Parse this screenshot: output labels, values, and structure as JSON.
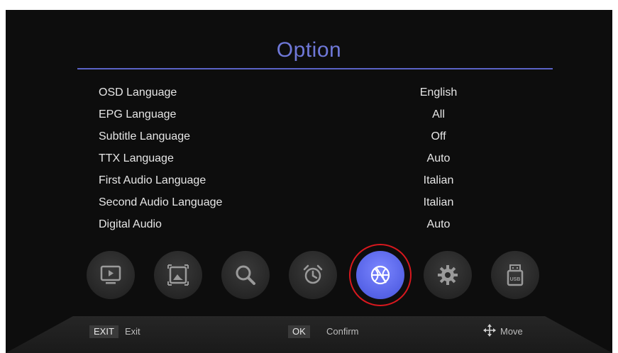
{
  "screen": {
    "title": "Option"
  },
  "menu": {
    "items": [
      {
        "label": "OSD Language",
        "value": "English"
      },
      {
        "label": "EPG Language",
        "value": "All"
      },
      {
        "label": "Subtitle Language",
        "value": "Off"
      },
      {
        "label": "TTX Language",
        "value": "Auto"
      },
      {
        "label": "First Audio Language",
        "value": "Italian"
      },
      {
        "label": "Second Audio Language",
        "value": "Italian"
      },
      {
        "label": "Digital Audio",
        "value": "Auto"
      }
    ]
  },
  "icon_bar": {
    "items": [
      {
        "icon": "tv-play-icon",
        "active": false
      },
      {
        "icon": "picture-icon",
        "active": false
      },
      {
        "icon": "search-icon",
        "active": false
      },
      {
        "icon": "alarm-clock-icon",
        "active": false
      },
      {
        "icon": "globe-basketball-icon",
        "active": true
      },
      {
        "icon": "gear-icon",
        "active": false
      },
      {
        "icon": "usb-icon",
        "active": false
      }
    ],
    "highlight_color": "#d8181e",
    "active_color": "#5a66e8"
  },
  "footer": {
    "exit_key": "EXIT",
    "exit_label": "Exit",
    "ok_key": "OK",
    "ok_label": "Confirm",
    "move_label": "Move"
  },
  "colors": {
    "background": "#0d0d0d",
    "accent": "#6f78d8",
    "text": "#e6e6e6"
  }
}
